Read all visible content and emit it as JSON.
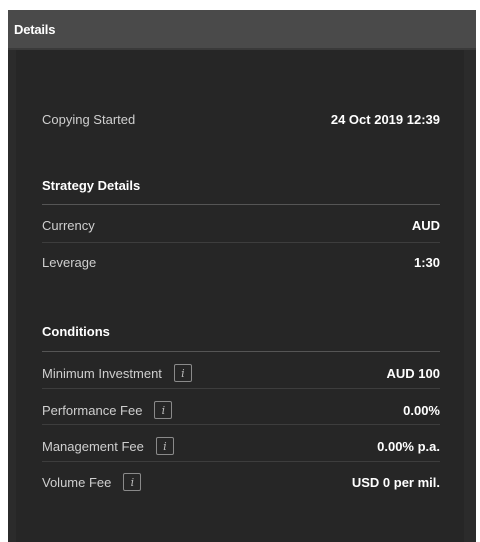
{
  "panel": {
    "title": "Details"
  },
  "copying": {
    "label": "Copying Started",
    "value": "24 Oct 2019 12:39"
  },
  "strategy": {
    "title": "Strategy Details",
    "rows": [
      {
        "label": "Currency",
        "value": "AUD"
      },
      {
        "label": "Leverage",
        "value": "1:30"
      }
    ]
  },
  "conditions": {
    "title": "Conditions",
    "rows": [
      {
        "label": "Minimum Investment",
        "value": "AUD 100",
        "icon": "info-icon"
      },
      {
        "label": "Performance Fee",
        "value": "0.00%",
        "icon": "info-icon"
      },
      {
        "label": "Management Fee",
        "value": "0.00% p.a.",
        "icon": "info-icon"
      },
      {
        "label": "Volume Fee",
        "value": "USD 0 per mil.",
        "icon": "info-icon"
      }
    ]
  },
  "info_glyph": "i",
  "colors": {
    "panel_bg": "#2b2b2b",
    "header_bg": "#4a4a4a",
    "text": "#ffffff",
    "muted": "#cfcfcf"
  }
}
